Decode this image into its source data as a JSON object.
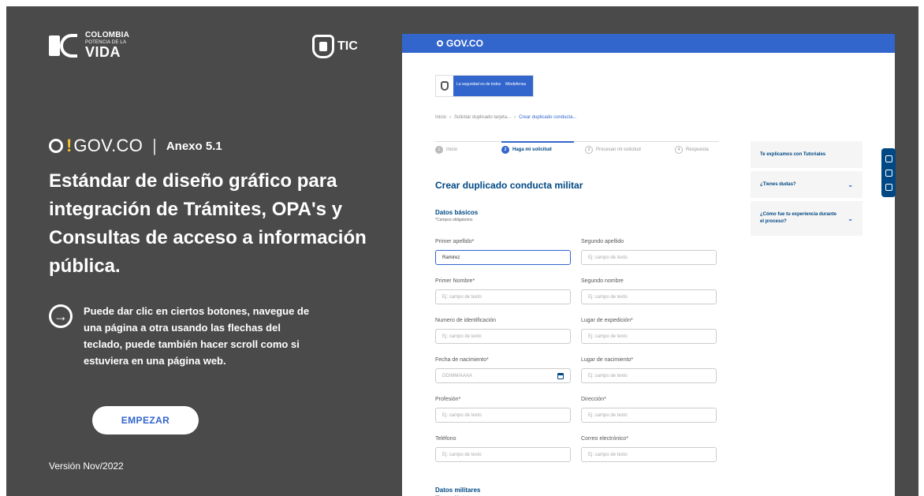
{
  "branding": {
    "colombia_line1": "COLOMBIA",
    "colombia_line2": "POTENCIA DE LA",
    "colombia_line3": "VIDA",
    "tic": "TIC"
  },
  "intro": {
    "govco": "GOV.CO",
    "annex": "Anexo 5.1",
    "headline": "Estándar de diseño gráfico para integración de Trámites, OPA's y Consultas de acceso a información pública.",
    "hint": "Puede dar clic en ciertos botones, navegue de una página a otra usando las flechas del teclado, puede también hacer scroll como si estuviera en una página web.",
    "start_button": "EMPEZAR",
    "version": "Versión Nov/2022"
  },
  "preview": {
    "top_bar": "GOV.CO",
    "ministry_slogan": "La seguridad es de todos",
    "ministry_name": "Mindefensa",
    "breadcrumbs": [
      "Inicio",
      "Solicitar duplicado tarjeta...",
      "Crear duplicado conducta..."
    ],
    "steps": [
      {
        "num": "1",
        "label": "Inicio"
      },
      {
        "num": "2",
        "label": "Haga mi solicitud"
      },
      {
        "num": "3",
        "label": "Procesan mi solicitud"
      },
      {
        "num": "4",
        "label": "Respuesta"
      }
    ],
    "form_title": "Crear duplicado conducta militar",
    "section_basic": "Datos básicos",
    "section_military": "Datos militares",
    "required_note": "*Campos obligatorios",
    "fields": [
      {
        "label": "Primer apellido*",
        "value": "Ramirez"
      },
      {
        "label": "Segundo apellido",
        "placeholder": "Ej: campo de texto"
      },
      {
        "label": "Primer Nombre*",
        "placeholder": "Ej: campo de texto"
      },
      {
        "label": "Segundo nombre",
        "placeholder": "Ej: campo de texto"
      },
      {
        "label": "Numero de identificación",
        "placeholder": "Ej: campo de texto"
      },
      {
        "label": "Lugar de expedición*",
        "placeholder": "Ej: campo de texto"
      },
      {
        "label": "Fecha de nacimiento*",
        "placeholder": "DD/MM/AAAA"
      },
      {
        "label": "Lugar de nacimiento*",
        "placeholder": "Ej: campo de texto"
      },
      {
        "label": "Profesión*",
        "placeholder": "Ej: campo de texto"
      },
      {
        "label": "Dirección*",
        "placeholder": "Ej: campo de texto"
      },
      {
        "label": "Teléfono",
        "placeholder": "Ej: campo de texto"
      },
      {
        "label": "Correo electrónico*",
        "placeholder": "Ej: campo de texto"
      }
    ],
    "side": {
      "tutorials": "Te explicamos con Tutoriales",
      "doubts": "¿Tienes dudas?",
      "experience": "¿Cómo fue tu experiencia durante el proceso?"
    }
  }
}
